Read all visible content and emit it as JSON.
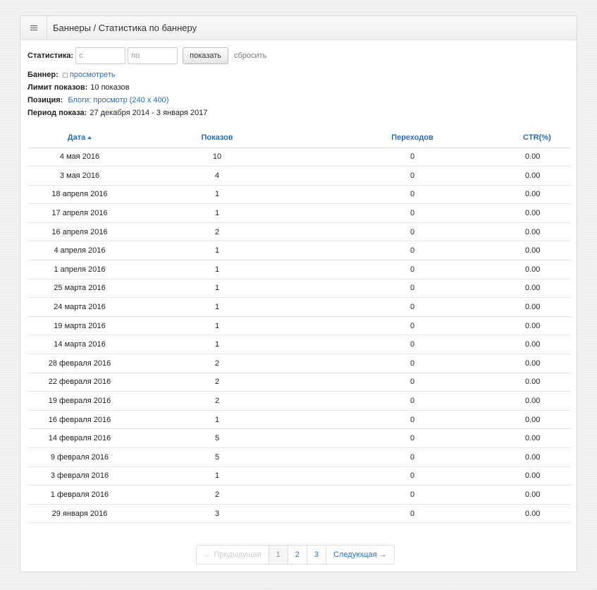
{
  "header": {
    "title": "Баннеры / Статистика по баннеру"
  },
  "filter": {
    "label": "Статистика:",
    "from_placeholder": "с",
    "to_placeholder": "по",
    "show_label": "показать",
    "reset_label": "сбросить"
  },
  "info": {
    "banner_label": "Баннер:",
    "banner_link": "просмотреть",
    "limit_label": "Лимит показов:",
    "limit_value": "10 показов",
    "position_label": "Позиция:",
    "position_value": "Блоги: просмотр (240 x 400)",
    "period_label": "Период показа:",
    "period_value": "27 декабря 2014 - 3 января 2017"
  },
  "table": {
    "headers": [
      "Дата",
      "Показов",
      "Переходов",
      "CTR(%)"
    ],
    "rows": [
      [
        "4 мая 2016",
        "10",
        "0",
        "0.00"
      ],
      [
        "3 мая 2016",
        "4",
        "0",
        "0.00"
      ],
      [
        "18 апреля 2016",
        "1",
        "0",
        "0.00"
      ],
      [
        "17 апреля 2016",
        "1",
        "0",
        "0.00"
      ],
      [
        "16 апреля 2016",
        "2",
        "0",
        "0.00"
      ],
      [
        "4 апреля 2016",
        "1",
        "0",
        "0.00"
      ],
      [
        "1 апреля 2016",
        "1",
        "0",
        "0.00"
      ],
      [
        "25 марта 2016",
        "1",
        "0",
        "0.00"
      ],
      [
        "24 марта 2016",
        "1",
        "0",
        "0.00"
      ],
      [
        "19 марта 2016",
        "1",
        "0",
        "0.00"
      ],
      [
        "14 марта 2016",
        "1",
        "0",
        "0.00"
      ],
      [
        "28 февраля 2016",
        "2",
        "0",
        "0.00"
      ],
      [
        "22 февраля 2016",
        "2",
        "0",
        "0.00"
      ],
      [
        "19 февраля 2016",
        "2",
        "0",
        "0.00"
      ],
      [
        "16 февраля 2016",
        "1",
        "0",
        "0.00"
      ],
      [
        "14 февраля 2016",
        "5",
        "0",
        "0.00"
      ],
      [
        "9 февраля 2016",
        "5",
        "0",
        "0.00"
      ],
      [
        "3 февраля 2016",
        "1",
        "0",
        "0.00"
      ],
      [
        "1 февраля 2016",
        "2",
        "0",
        "0.00"
      ],
      [
        "29 января 2016",
        "3",
        "0",
        "0.00"
      ]
    ]
  },
  "pagination": {
    "prev": "← Предыдущая",
    "pages": [
      "1",
      "2",
      "3"
    ],
    "next": "Следующая →"
  }
}
